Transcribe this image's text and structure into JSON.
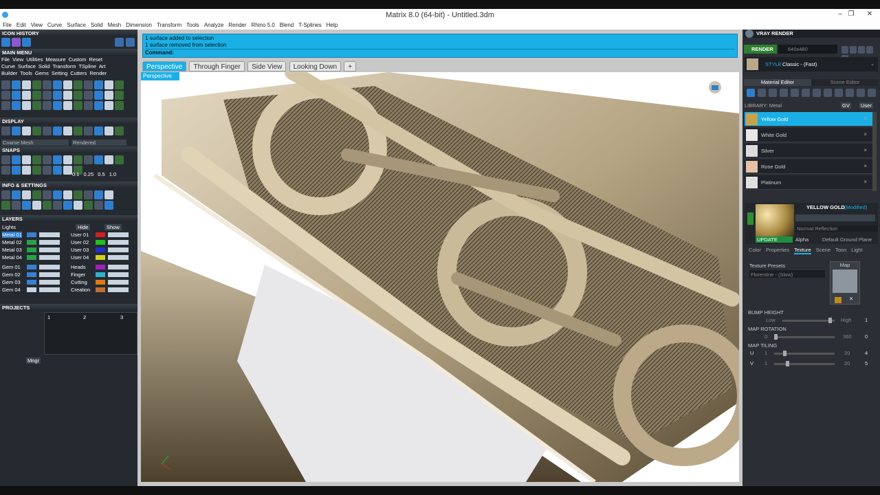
{
  "window": {
    "title": "Matrix 8.0 (64-bit) - Untitled.3dm"
  },
  "menu": [
    "File",
    "Edit",
    "View",
    "Curve",
    "Surface",
    "Solid",
    "Mesh",
    "Dimension",
    "Transform",
    "Tools",
    "Analyze",
    "Render",
    "Rhino 5.0",
    "Blend",
    "T-Splines",
    "Help"
  ],
  "left": {
    "icon_history": "ICON HISTORY",
    "main_menu": "MAIN MENU",
    "main_menu_row1": [
      "File",
      "View",
      "Utilities",
      "Measure",
      "Custom",
      "Reset"
    ],
    "main_menu_row2": [
      "Curve",
      "Surface",
      "Solid",
      "Transform",
      "TSpline",
      "Art"
    ],
    "main_menu_row3": [
      "Builder",
      "Tools",
      "Gems",
      "Setting",
      "Cutters",
      "Render"
    ],
    "display": "DISPLAY",
    "display_mode_1": "Coarse Mesh",
    "display_mode_2": "Rendered",
    "snaps": "SNAPS",
    "snap_values": [
      "0.1",
      "0.25",
      "0.5",
      "1.0"
    ],
    "info_settings": "INFO & SETTINGS",
    "layers": "LAYERS",
    "layers_lights": "Lights",
    "layers_hide": "Hide",
    "layers_show": "Show",
    "layers_col1": [
      "Metal 01",
      "Metal 02",
      "Metal 03",
      "Metal 04",
      "Gem 01",
      "Gem 02",
      "Gem 03",
      "Gem 04"
    ],
    "layers_col2": [
      "User 01",
      "User 02",
      "User 03",
      "User 04",
      "Heads",
      "Finger",
      "Cutting",
      "Creation"
    ],
    "projects": "PROJECTS",
    "project_slots": [
      "1",
      "2",
      "3"
    ],
    "mngr": "Mngr"
  },
  "command": {
    "lines": [
      "1 surface added to selection",
      "1 surface removed from selection"
    ],
    "prompt": "Command:"
  },
  "tabs": [
    {
      "label": "Perspective",
      "active": true
    },
    {
      "label": "Through Finger",
      "active": false
    },
    {
      "label": "Side View",
      "active": false
    },
    {
      "label": "Looking Down",
      "active": false
    }
  ],
  "tab_add": "+",
  "viewport": {
    "label": "Perspective"
  },
  "right": {
    "header": "VRAY RENDER",
    "render_btn": "RENDER",
    "resolution": "640x480",
    "style_label": "STYLE",
    "style_value": "Classic - (Fast)",
    "material_editor": "Material Editor",
    "scene_editor": "Scene Editor",
    "library_label": "LIBRARY: Metal",
    "gv": "GV",
    "user": "User",
    "materials": [
      "Yellow Gold",
      "White Gold",
      "Silver",
      "Rose Gold",
      "Platinum"
    ],
    "selected_material": "YELLOW GOLD",
    "modified": "(Modified)",
    "reflection": "Normal Reflection",
    "update": "UPDATE",
    "alpha": "Alpha",
    "ground_plane": "Default Ground Plane",
    "subtabs": [
      "Color",
      "Properties",
      "Texture",
      "Scene",
      "Toon",
      "Light"
    ],
    "active_subtab": "Texture",
    "texture_presets": "Texture Presets",
    "preset_value": "Florentine - (Slow)",
    "map": "Map",
    "bump_height": "BUMP HEIGHT",
    "bump_low": "Low",
    "bump_high": "High",
    "bump_value": "1",
    "map_rotation": "MAP ROTATION",
    "rot_min": "0",
    "rot_max": "360",
    "rot_value": "0",
    "map_tiling": "MAP TILING",
    "u_label": "U",
    "v_label": "V",
    "u_min": "1",
    "u_max": "20",
    "u_value": "4",
    "v_min": "1",
    "v_max": "20",
    "v_value": "5"
  }
}
